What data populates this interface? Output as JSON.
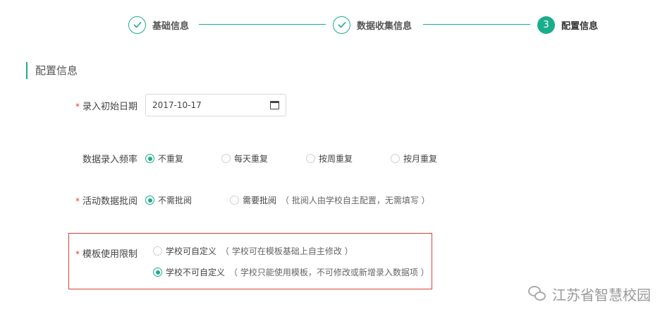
{
  "steps": [
    {
      "label": "基础信息",
      "state": "done"
    },
    {
      "label": "数据收集信息",
      "state": "done"
    },
    {
      "label": "配置信息",
      "state": "active",
      "number": "3"
    }
  ],
  "section": {
    "title": "配置信息"
  },
  "form": {
    "start_date": {
      "label": "录入初始日期",
      "required": "*",
      "value": "2017-10-17"
    },
    "frequency": {
      "label": "数据录入频率",
      "options": [
        "不重复",
        "每天重复",
        "按周重复",
        "按月重复"
      ],
      "selected": "不重复"
    },
    "review": {
      "label": "活动数据批阅",
      "required": "*",
      "options": [
        "不需批阅",
        "需要批阅"
      ],
      "hint": "（ 批阅人由学校自主配置，无需填写 ）",
      "selected": "不需批阅"
    },
    "template": {
      "label": "模板使用限制",
      "required": "*",
      "option_custom": "学校可自定义",
      "option_custom_hint": "（ 学校可在模板基础上自主修改 ）",
      "option_fixed": "学校不可自定义",
      "option_fixed_hint": "（ 学校只能使用模板，不可修改或新增录入数据项 ）",
      "selected": "学校不可自定义"
    }
  },
  "watermark": {
    "text": "江苏省智慧校园"
  },
  "colors": {
    "accent": "#1aad8c",
    "required": "#e03c3c",
    "highlight_box": "#d9403a"
  }
}
